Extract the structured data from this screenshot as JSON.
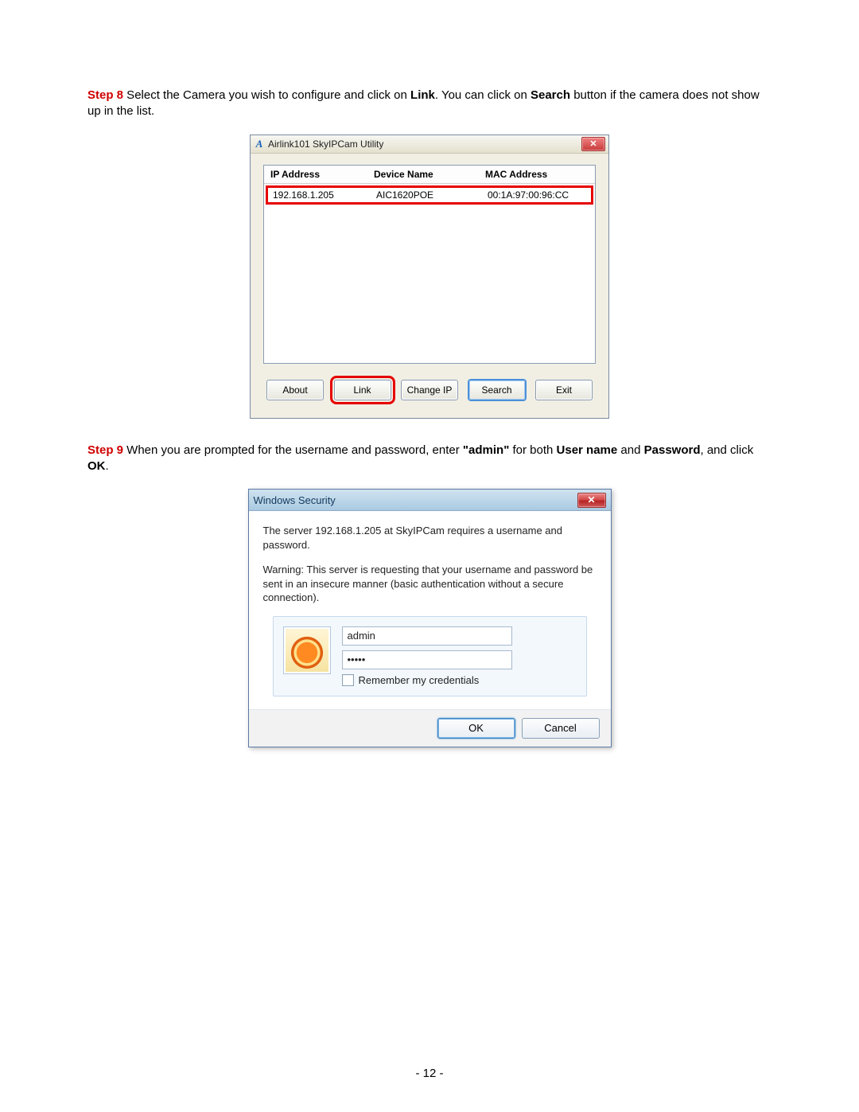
{
  "step8": {
    "label": "Step 8",
    "text_a": " Select the Camera you wish to configure and click on ",
    "bold_link": "Link",
    "text_b": ". You can click on ",
    "bold_search": "Search",
    "text_c": " button if the camera does not show up in the list."
  },
  "util": {
    "title": "Airlink101 SkyIPCam Utility",
    "app_icon_glyph": "A",
    "close_glyph": "✕",
    "columns": {
      "ip": "IP Address",
      "name": "Device Name",
      "mac": "MAC Address"
    },
    "rows": [
      {
        "ip": "192.168.1.205",
        "name": "AIC1620POE",
        "mac": "00:1A:97:00:96:CC"
      }
    ],
    "buttons": {
      "about": "About",
      "link": "Link",
      "change_ip": "Change IP",
      "search": "Search",
      "exit": "Exit"
    }
  },
  "step9": {
    "label": "Step 9",
    "text_a": " When you are prompted for the username and password, enter ",
    "bold_admin": "\"admin\"",
    "text_b": " for both ",
    "bold_user": "User name",
    "text_c": " and ",
    "bold_pass": "Password",
    "text_d": ", and click ",
    "bold_ok": "OK",
    "text_e": "."
  },
  "sec": {
    "title": "Windows Security",
    "close_glyph": "✕",
    "line1": "The server 192.168.1.205 at SkyIPCam requires a username and password.",
    "line2": "Warning: This server is requesting that your username and password be sent in an insecure manner (basic authentication without a secure connection).",
    "username_value": "admin",
    "password_value": "•••••",
    "remember_label": "Remember my credentials",
    "ok": "OK",
    "cancel": "Cancel"
  },
  "page_number": "- 12 -"
}
